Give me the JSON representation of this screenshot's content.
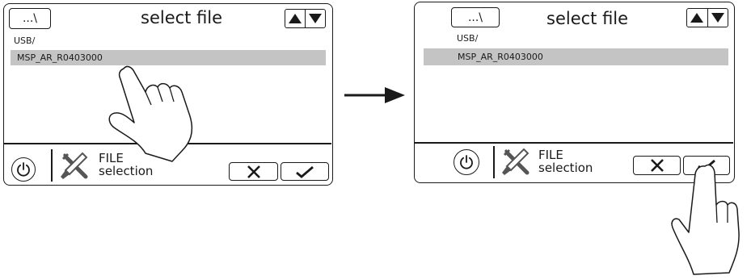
{
  "screens": [
    {
      "back_label": "...\\",
      "title": "select file",
      "path": "USB/",
      "selected_file": "MSP_AR_R0403000",
      "footer_line1": "FILE",
      "footer_line2": "selection"
    },
    {
      "back_label": "...\\",
      "title": "select file",
      "path": "USB/",
      "selected_file": "MSP_AR_R0403000",
      "footer_line1": "FILE",
      "footer_line2": "selection"
    }
  ],
  "icons": {
    "back": "folder-up",
    "scroll_up": "triangle-up",
    "scroll_down": "triangle-down",
    "power": "power-icon",
    "tools": "wrench-screwdriver-icon",
    "cancel": "x-mark-icon",
    "confirm": "check-mark-icon",
    "hand": "pointing-hand-icon",
    "transition": "right-arrow-icon"
  },
  "colors": {
    "selection": "#c4c4c4",
    "line": "#1a1a1a",
    "tool_icon": "#555555"
  }
}
